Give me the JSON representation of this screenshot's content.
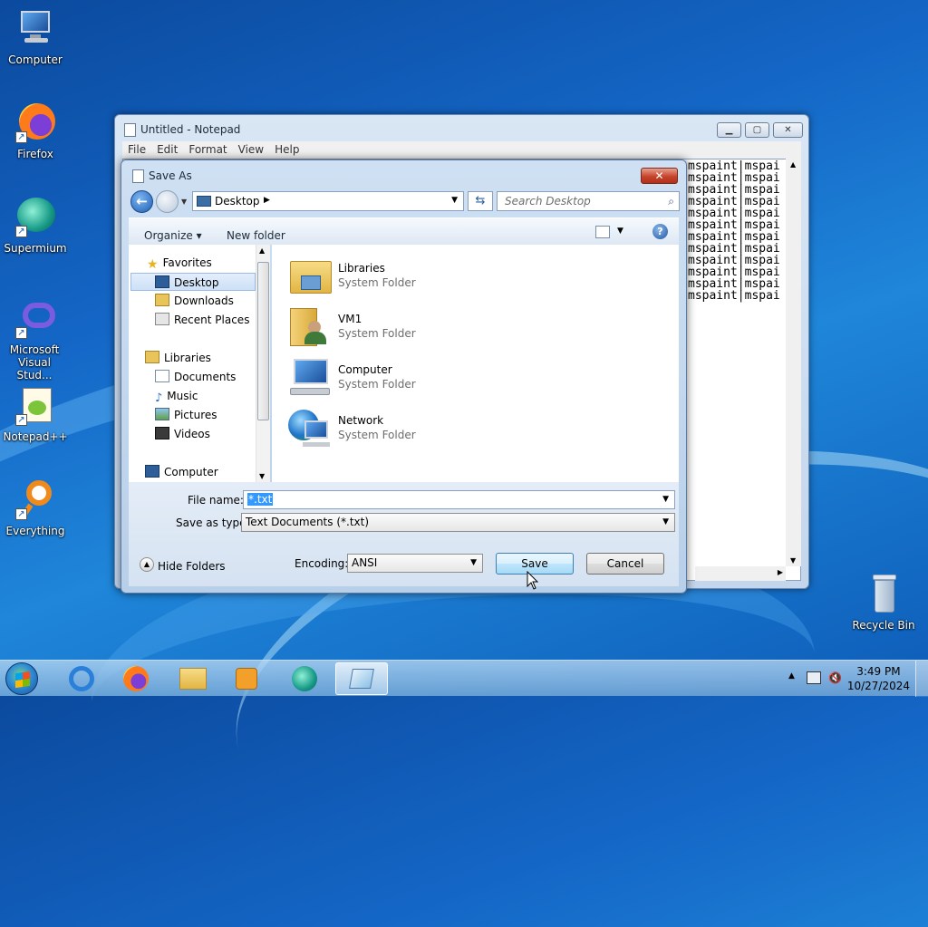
{
  "desktop": {
    "icons": [
      {
        "label": "Computer"
      },
      {
        "label": "Firefox"
      },
      {
        "label": "Supermium"
      },
      {
        "label": "Microsoft Visual Stud..."
      },
      {
        "label": "Notepad++"
      },
      {
        "label": "Everything"
      },
      {
        "label": "Recycle Bin"
      }
    ]
  },
  "notepad": {
    "title": "Untitled - Notepad",
    "menu": [
      "File",
      "Edit",
      "Format",
      "View",
      "Help"
    ],
    "content_line": "mspaint|mspai",
    "line_count": 12
  },
  "dialog": {
    "title": "Save As",
    "close_label": "✕",
    "address": "Desktop",
    "search_placeholder": "Search Desktop",
    "toolbar": {
      "organize": "Organize ▾",
      "new_folder": "New folder"
    },
    "nav": {
      "favorites": "Favorites",
      "desktop": "Desktop",
      "downloads": "Downloads",
      "recent": "Recent Places",
      "libraries": "Libraries",
      "documents": "Documents",
      "music": "Music",
      "pictures": "Pictures",
      "videos": "Videos",
      "computer": "Computer"
    },
    "files": [
      {
        "name": "Libraries",
        "type": "System Folder"
      },
      {
        "name": "VM1",
        "type": "System Folder"
      },
      {
        "name": "Computer",
        "type": "System Folder"
      },
      {
        "name": "Network",
        "type": "System Folder"
      }
    ],
    "file_name_label": "File name:",
    "file_name_value": "*.txt",
    "save_type_label": "Save as type:",
    "save_type_value": "Text Documents (*.txt)",
    "hide_folders": "Hide Folders",
    "encoding_label": "Encoding:",
    "encoding_value": "ANSI",
    "save": "Save",
    "cancel": "Cancel"
  },
  "taskbar": {
    "time": "3:49 PM",
    "date": "10/27/2024"
  },
  "colors": {
    "accent": "#3399ff",
    "desktop_blue": "#1466c6"
  }
}
